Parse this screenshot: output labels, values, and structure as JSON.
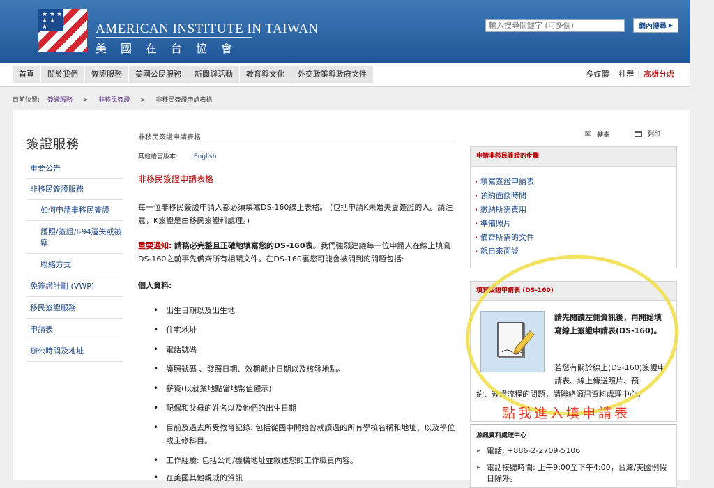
{
  "header": {
    "org_en": "AMERICAN INSTITUTE IN TAIWAN",
    "org_zh": "美國在台協會",
    "search_placeholder": "輸入搜尋關鍵字 (可多個)",
    "search_button": "網內搜尋"
  },
  "nav": {
    "items": [
      "首頁",
      "關於我們",
      "簽證服務",
      "美國公民服務",
      "新聞與活動",
      "教育與文化",
      "外交政策與政府文件"
    ],
    "right": [
      "多媒體",
      "社群",
      "高雄分處"
    ]
  },
  "breadcrumb": {
    "label": "目前位置:",
    "items": [
      "簽證服務",
      "非移民簽證",
      "非移民簽證申請表格"
    ]
  },
  "sidebar": {
    "title": "簽證服務",
    "items": [
      "重要公告",
      "非移民簽證服務",
      "如何申請非移民簽證",
      "護照/簽證/I-94遺失或被竊",
      "聯絡方式",
      "免簽證計劃 (VWP)",
      "移民簽證服務",
      "申請表",
      "辦公時間及地址"
    ]
  },
  "main": {
    "title": "非移民簽證申請表格",
    "other_lang_label": "其他語言版本:",
    "other_lang_link": "English",
    "heading": "非移民簽證申請表格",
    "para1": "每一位非移民簽證申請人都必須填寫DS-160線上表格。 (包括申請K未婚夫妻簽證的人。請注意，K簽證是由移民簽證科處理。)",
    "notice_label": "重要通知:",
    "notice_bold": "請務必完整且正確地填寫您的DS-160表",
    "notice_rest": "。我們強烈建議每一位申請人在線上填寫DS-160之前事先備齊所有相關文件。在DS-160裏您可能會被問到的問題包括:",
    "personal_heading": "個人資料:",
    "bullets": [
      "出生日期以及出生地",
      "住宅地址",
      "電話號碼",
      "護照號碼 、發照日期、效期截止日期以及核發地點。",
      "薪資(以就業地點當地幣值顯示)",
      "配偶和父母的姓名以及他們的出生日期",
      "目前及過去所受教育記錄: 包括從國中開始曾就讀過的所有學校名稱和地址、以及學位或主修科目。",
      "工作經驗: 包括公司/機構地址並敘述您的工作職責內容。",
      "在美國其他親戚的資訊"
    ]
  },
  "tools": {
    "send": "轉寄",
    "print": "列印"
  },
  "steps_box": {
    "title": "申請非移民簽證的步驟",
    "items": [
      "填寫簽證申請表",
      "預約面談時間",
      "繳納所需費用",
      "準備照片",
      "備齊所需的文件",
      "親自來面談"
    ]
  },
  "ds_box": {
    "title": "填寫簽證申請表 (DS-160)",
    "bold_text": "請先閱讀左側資訊後，再開始填寫線上簽證申請表(DS-160)。",
    "text": "若您有關於線上(DS-160)簽證申請表、線上傳送照片、預",
    "text2": "約、簽證流程的問題，請聯絡源訊資料處理中心。",
    "handwritten": "點我進入填申請表"
  },
  "center_box": {
    "title": "源訊資料處理中心",
    "phone": "電話: +886-2-2709-5106",
    "hours": "電話接聽時間: 上午9:00至下午4:00，台灣/美國例假日除外。"
  }
}
